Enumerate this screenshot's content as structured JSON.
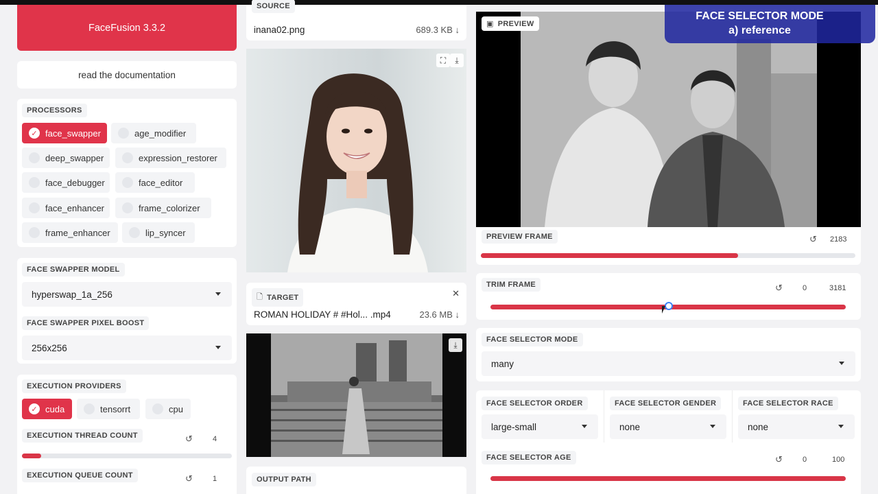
{
  "app": {
    "title": "FaceFusion 3.3.2",
    "docs_link": "read the documentation"
  },
  "processors": {
    "label": "PROCESSORS",
    "items": [
      {
        "label": "face_swapper",
        "checked": true
      },
      {
        "label": "age_modifier",
        "checked": false
      },
      {
        "label": "deep_swapper",
        "checked": false
      },
      {
        "label": "expression_restorer",
        "checked": false
      },
      {
        "label": "face_debugger",
        "checked": false
      },
      {
        "label": "face_editor",
        "checked": false
      },
      {
        "label": "face_enhancer",
        "checked": false
      },
      {
        "label": "frame_colorizer",
        "checked": false
      },
      {
        "label": "frame_enhancer",
        "checked": false
      },
      {
        "label": "lip_syncer",
        "checked": false
      }
    ]
  },
  "face_swapper": {
    "model_label": "FACE SWAPPER MODEL",
    "model_value": "hyperswap_1a_256",
    "pixel_boost_label": "FACE SWAPPER PIXEL BOOST",
    "pixel_boost_value": "256x256"
  },
  "execution": {
    "providers_label": "EXECUTION PROVIDERS",
    "providers": [
      {
        "label": "cuda",
        "checked": true
      },
      {
        "label": "tensorrt",
        "checked": false
      },
      {
        "label": "cpu",
        "checked": false
      }
    ],
    "thread_label": "EXECUTION THREAD COUNT",
    "thread_value": "4",
    "thread_fraction": 0.09,
    "queue_label": "EXECUTION QUEUE COUNT",
    "queue_value": "1"
  },
  "source": {
    "label": "SOURCE",
    "filename": "inana02.png",
    "size": "689.3 KB ↓"
  },
  "target": {
    "label": "TARGET",
    "filename": "ROMAN HOLIDAY # #Hol... .mp4",
    "size": "23.6 MB ↓"
  },
  "output": {
    "label": "OUTPUT PATH"
  },
  "preview": {
    "label": "PREVIEW",
    "frame_label": "PREVIEW FRAME",
    "frame_value": "2183",
    "frame_fraction": 0.686
  },
  "trim": {
    "label": "TRIM FRAME",
    "start": "0",
    "end": "3181"
  },
  "face_selector": {
    "mode_label": "FACE SELECTOR MODE",
    "mode_value": "many",
    "order_label": "FACE SELECTOR ORDER",
    "order_value": "large-small",
    "gender_label": "FACE SELECTOR GENDER",
    "gender_value": "none",
    "race_label": "FACE SELECTOR RACE",
    "race_value": "none",
    "age_label": "FACE SELECTOR AGE",
    "age_start": "0",
    "age_end": "100"
  },
  "overlay": {
    "line1": "FACE SELECTOR MODE",
    "line2": "a) reference"
  },
  "icons": {
    "reset": "↺",
    "download": "⤓",
    "fullscreen": "⛶",
    "close": "✕",
    "file": "🗋",
    "image": "▣",
    "check": "✓"
  },
  "colors": {
    "accent": "#e0344a",
    "overlay": "#2a2f9e"
  }
}
